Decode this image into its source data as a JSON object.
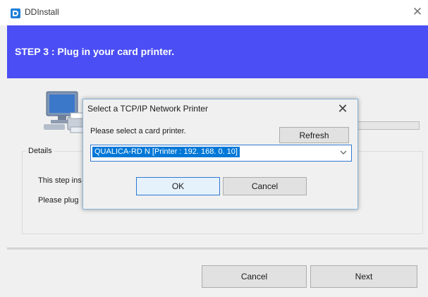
{
  "app": {
    "title": "DDInstall",
    "icon": "dd-logo-icon",
    "close_glyph": "✕"
  },
  "header": {
    "step_title": "STEP 3 :  Plug in your card printer.",
    "accent_color": "#4a4ef4"
  },
  "details": {
    "legend": "Details",
    "line1": "This step ins",
    "line2": "Please plug"
  },
  "footer": {
    "cancel_label": "Cancel",
    "next_label": "Next"
  },
  "dialog": {
    "title": "Select a TCP/IP Network Printer",
    "close_glyph": "✕",
    "prompt": "Please select a card printer.",
    "refresh_label": "Refresh",
    "printer_select": {
      "selected": "QUALICA-RD N [Printer : 192. 168. 0. 10]",
      "selection_color": "#0078d7"
    },
    "ok_label": "OK",
    "cancel_label": "Cancel"
  },
  "icons": {
    "computer": "computer-printer-icon",
    "dropdown": "chevron-down-icon"
  }
}
